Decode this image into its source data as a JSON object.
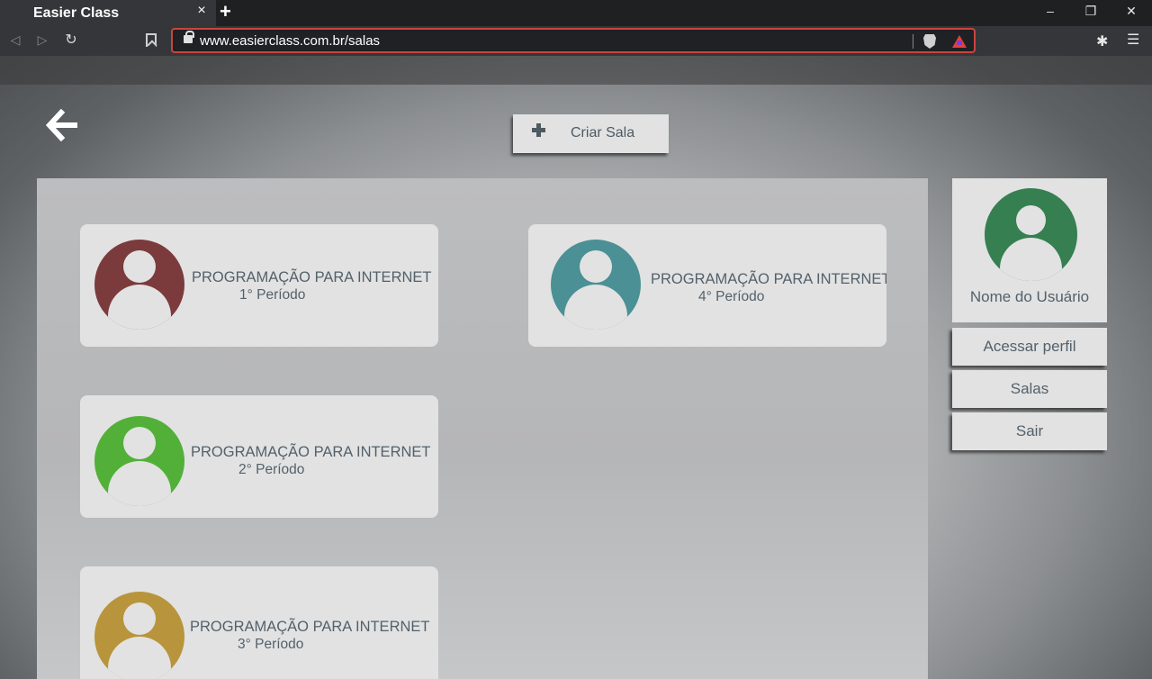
{
  "browser": {
    "tab_title": "Easier Class",
    "tab_close": "×",
    "new_tab": "+",
    "window_controls": {
      "minimize": "–",
      "restore": "❐",
      "close": "✕"
    },
    "nav": {
      "back": "◁",
      "forward": "▷",
      "reload": "↻"
    },
    "url": "www.easierclass.com.br/salas",
    "extensions_icon": "✱",
    "menu_icon": "☰"
  },
  "page": {
    "create_room_label": "Criar Sala",
    "rooms": [
      {
        "title": "PROGRAMAÇÃO PARA INTERNET",
        "period": "1° Período",
        "color": "#7b3b3c"
      },
      {
        "title": "PROGRAMAÇÃO PARA INTERNET",
        "period": "4° Período",
        "color": "#4a9094"
      },
      {
        "title": "PROGRAMAÇÃO PARA INTERNET",
        "period": "2° Período",
        "color": "#52b038"
      },
      {
        "title": "PROGRAMAÇÃO PARA INTERNET",
        "period": "3° Período",
        "color": "#b8953c"
      }
    ]
  },
  "sidebar": {
    "user_name": "Nome do Usuário",
    "avatar_color": "#357f50",
    "menu": [
      {
        "label": "Acessar perfil"
      },
      {
        "label": "Salas"
      },
      {
        "label": "Sair"
      }
    ]
  },
  "colors": {
    "accent_text": "#53616b",
    "card_bg": "#e2e2e2",
    "address_border": "#c8453f"
  }
}
